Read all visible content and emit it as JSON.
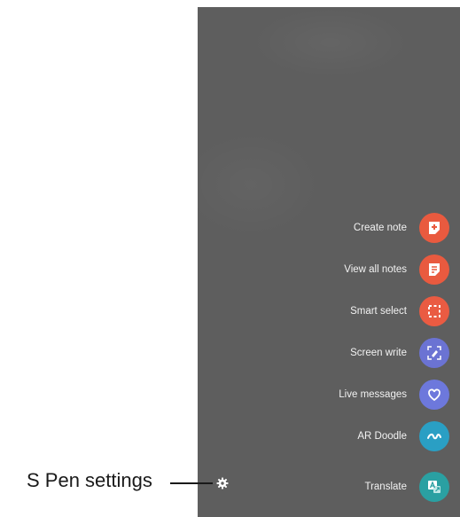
{
  "menu": {
    "items": [
      {
        "label": "Create note",
        "icon": "create-note-icon",
        "color": "#e95a3f"
      },
      {
        "label": "View all notes",
        "icon": "view-all-notes-icon",
        "color": "#e95a3f"
      },
      {
        "label": "Smart select",
        "icon": "smart-select-icon",
        "color": "#ea5b42"
      },
      {
        "label": "Screen write",
        "icon": "screen-write-icon",
        "color": "#6b73d3"
      },
      {
        "label": "Live messages",
        "icon": "live-messages-icon",
        "color": "#6d78dc"
      },
      {
        "label": "AR Doodle",
        "icon": "ar-doodle-icon",
        "color": "#2a9fc4"
      },
      {
        "label": "Translate",
        "icon": "translate-icon",
        "color": "#2aa0a2"
      }
    ]
  },
  "callout": {
    "text": "S Pen settings",
    "icon": "gear-icon"
  }
}
